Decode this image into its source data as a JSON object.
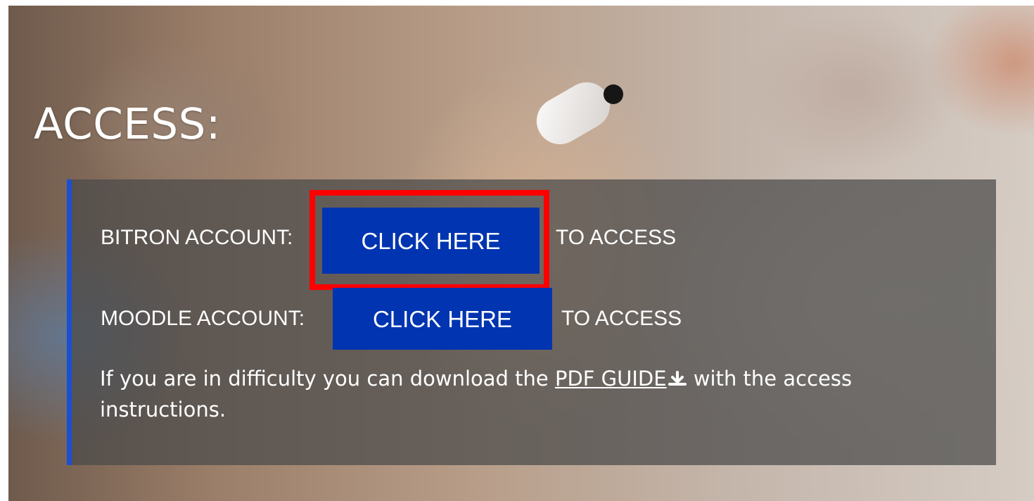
{
  "title": "ACCESS:",
  "rows": [
    {
      "label": "BITRON ACCOUNT:",
      "button_label": "CLICK HERE",
      "suffix": "TO ACCESS"
    },
    {
      "label": "MOODLE ACCOUNT:",
      "button_label": "CLICK HERE",
      "suffix": "TO ACCESS"
    }
  ],
  "guide": {
    "prefix": "If you are in difficulty you can download the",
    "link_label": "PDF GUIDE",
    "suffix": "with the access instructions."
  },
  "icons": {
    "download": "download-icon"
  },
  "colors": {
    "button_bg": "#0134b0",
    "accent_border": "#1950d2",
    "highlight": "#ff0000",
    "panel_bg": "rgba(74,74,74,0.73)"
  }
}
